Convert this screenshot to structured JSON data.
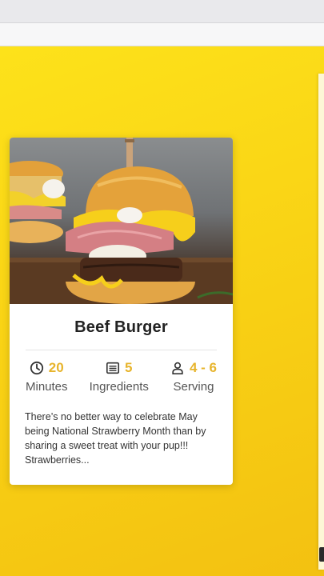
{
  "recipe": {
    "title": "Beef Burger",
    "image_alt": "Beef burger with ham and melted cheese",
    "stats": [
      {
        "icon": "clock-icon",
        "value": "20",
        "label": "Minutes"
      },
      {
        "icon": "list-icon",
        "value": "5",
        "label": "Ingredients"
      },
      {
        "icon": "person-icon",
        "value": "4 - 6",
        "label": "Serving"
      }
    ],
    "description": "There’s no better way to celebrate May being National Strawberry Month than by sharing a sweet treat with your pup!!! Strawberries..."
  },
  "colors": {
    "accent": "#e7b42c",
    "background": "#f9d315",
    "card": "#ffffff"
  }
}
